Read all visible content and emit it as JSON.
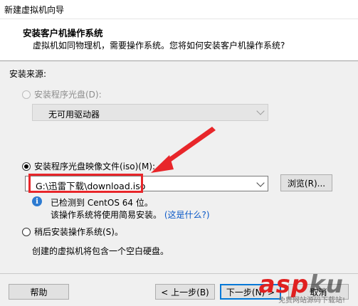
{
  "window": {
    "title": "新建虚拟机向导"
  },
  "header": {
    "title": "安装客户机操作系统",
    "subtitle": "虚拟机如同物理机，需要操作系统。您将如何安装客户机操作系统?"
  },
  "source_label": "安装来源:",
  "options": {
    "disc": {
      "label": "安装程序光盘(D):",
      "selected": false,
      "enabled": false
    },
    "disc_combo": {
      "value": "无可用驱动器"
    },
    "iso": {
      "label": "安装程序光盘映像文件(iso)(M):",
      "selected": true
    },
    "iso_path": {
      "value": "G:\\迅雷下载\\download.iso"
    },
    "browse_button": "浏览(R)...",
    "detected_line1": "已检测到 CentOS 64 位。",
    "detected_line2_prefix": "该操作系统将使用简易安装。",
    "detected_link": "(这是什么?)",
    "later": {
      "label": "稍后安装操作系统(S)。",
      "selected": false
    },
    "later_desc": "创建的虚拟机将包含一个空白硬盘。"
  },
  "footer": {
    "help": "帮助",
    "back": "< 上一步(B)",
    "next": "下一步(N) >",
    "cancel": "取消"
  },
  "watermark": {
    "brand_a": "asp",
    "brand_b": "ku",
    "sub": "免费网站源码下载站!"
  },
  "colors": {
    "highlight": "#e8262a",
    "link": "#0a58c7",
    "info_icon": "#2d7bd1"
  }
}
